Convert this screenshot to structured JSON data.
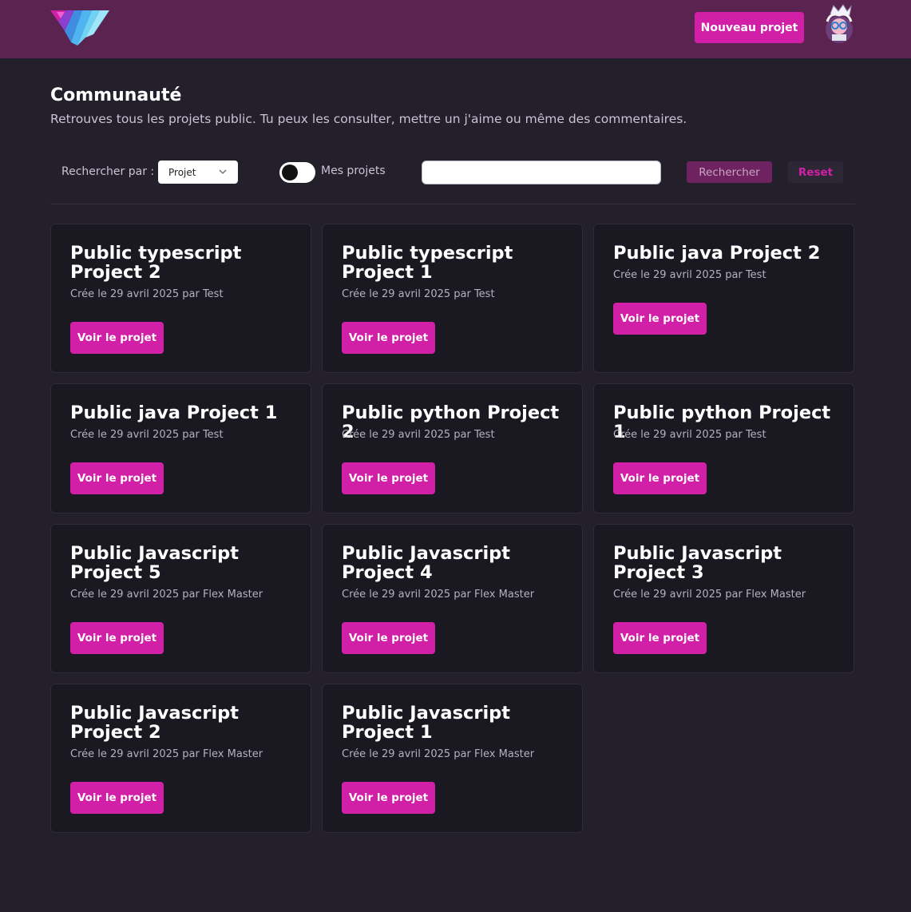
{
  "header": {
    "new_project_label": "Nouveau projet"
  },
  "page": {
    "title": "Communauté",
    "subtitle": "Retrouves tous les projets public. Tu peux les consulter, mettre un j'aime ou même des commentaires."
  },
  "filters": {
    "search_by_label": "Rechercher par :",
    "search_by_value": "Projet",
    "my_projects_label": "Mes projets",
    "my_projects_enabled": false,
    "search_value": "",
    "search_button_label": "Rechercher",
    "reset_button_label": "Reset"
  },
  "colors": {
    "accent": "#d21fa8",
    "header_bg": "#5a2350",
    "page_bg": "#23202c",
    "card_bg": "#1a1820"
  },
  "projects": [
    {
      "title": "Public typescript Project 2",
      "meta": "Crée le 29 avril 2025 par Test",
      "button": "Voir le projet"
    },
    {
      "title": "Public typescript Project 1",
      "meta": "Crée le 29 avril 2025 par Test",
      "button": "Voir le projet"
    },
    {
      "title": "Public java Project 2",
      "meta": "Crée le 29 avril 2025 par Test",
      "button": "Voir le projet"
    },
    {
      "title": "Public java Project 1",
      "meta": "Crée le 29 avril 2025 par Test",
      "button": "Voir le projet"
    },
    {
      "title": "Public python Project 2",
      "meta": "Crée le 29 avril 2025 par Test",
      "button": "Voir le projet"
    },
    {
      "title": "Public python Project 1",
      "meta": "Crée le 29 avril 2025 par Test",
      "button": "Voir le projet"
    },
    {
      "title": "Public Javascript Project 5",
      "meta": "Crée le 29 avril 2025 par Flex Master",
      "button": "Voir le projet"
    },
    {
      "title": "Public Javascript Project 4",
      "meta": "Crée le 29 avril 2025 par Flex Master",
      "button": "Voir le projet"
    },
    {
      "title": "Public Javascript Project 3",
      "meta": "Crée le 29 avril 2025 par Flex Master",
      "button": "Voir le projet"
    },
    {
      "title": "Public Javascript Project 2",
      "meta": "Crée le 29 avril 2025 par Flex Master",
      "button": "Voir le projet"
    },
    {
      "title": "Public Javascript Project 1",
      "meta": "Crée le 29 avril 2025 par Flex Master",
      "button": "Voir le projet"
    }
  ]
}
